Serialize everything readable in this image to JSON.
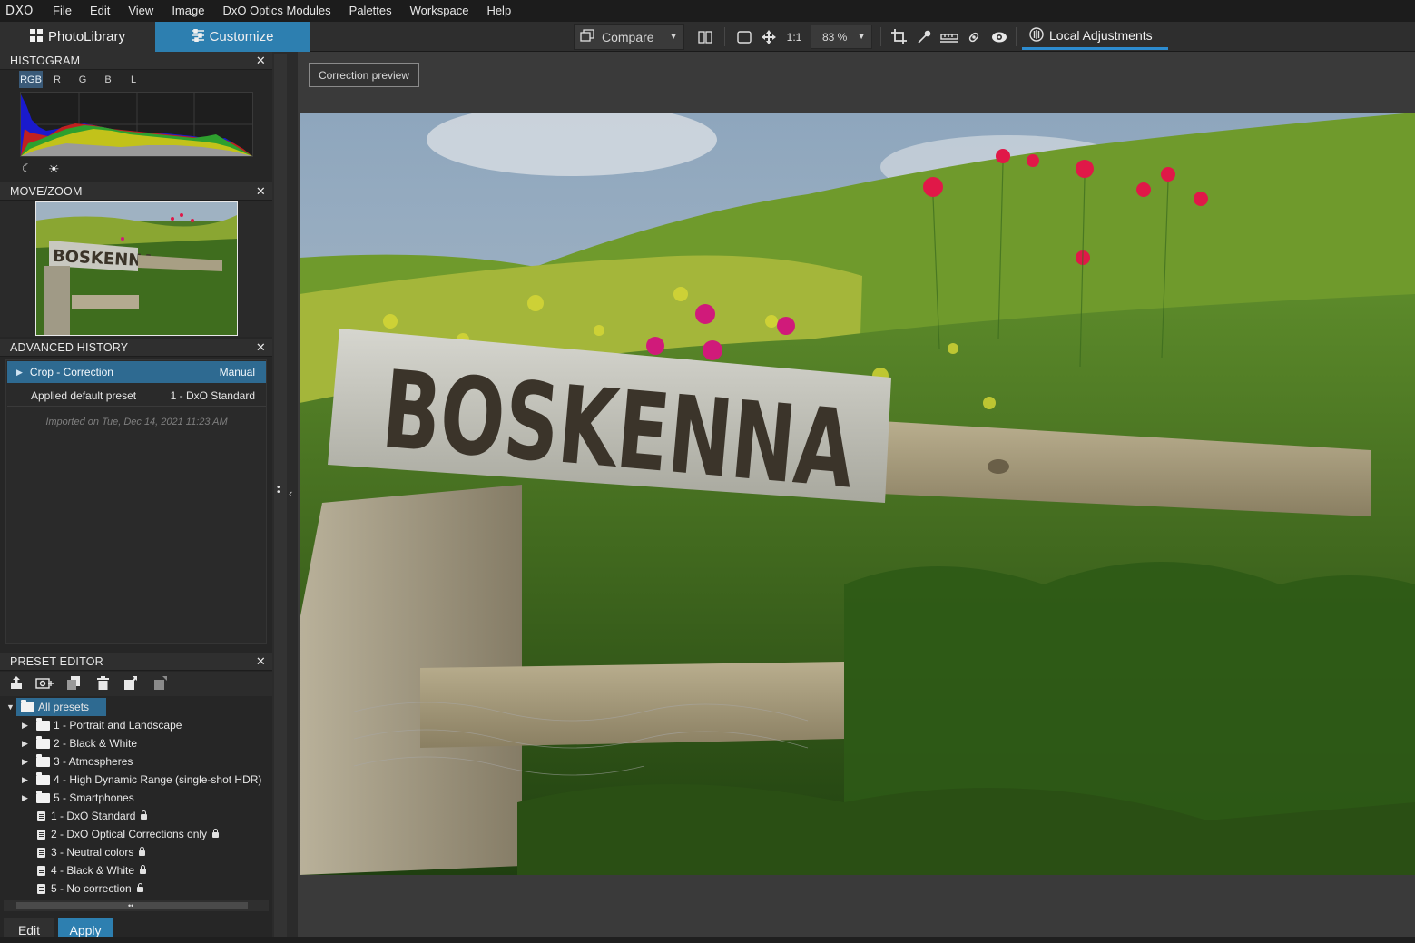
{
  "app": {
    "logo": "DXO"
  },
  "menu": [
    "File",
    "Edit",
    "View",
    "Image",
    "DxO Optics Modules",
    "Palettes",
    "Workspace",
    "Help"
  ],
  "modes": {
    "photolibrary": "PhotoLibrary",
    "customize": "Customize"
  },
  "toolbar": {
    "compare_label": "Compare",
    "one_to_one": "1:1",
    "zoom_value": "83 %",
    "local_adjustments": "Local Adjustments"
  },
  "histogram": {
    "title": "HISTOGRAM",
    "channels": [
      "RGB",
      "R",
      "G",
      "B",
      "L"
    ],
    "selected_channel": "RGB"
  },
  "movezoom": {
    "title": "MOVE/ZOOM",
    "sign_text": "BOSKENNA"
  },
  "history": {
    "title": "ADVANCED HISTORY",
    "rows": [
      {
        "action": "Crop - Correction",
        "value": "Manual"
      },
      {
        "action": "Applied default preset",
        "value": "1 - DxO Standard"
      }
    ],
    "imported": "Imported on Tue, Dec 14, 2021 11:23 AM"
  },
  "preset_editor": {
    "title": "PRESET EDITOR",
    "root": "All presets",
    "folders": [
      "1 - Portrait and Landscape",
      "2 - Black & White",
      "3 - Atmospheres",
      "4 - High Dynamic Range (single-shot HDR)",
      "5 - Smartphones"
    ],
    "presets": [
      "1 - DxO Standard",
      "2 - DxO Optical Corrections only",
      "3 - Neutral colors",
      "4 - Black & White",
      "5 - No correction"
    ],
    "edit_label": "Edit",
    "apply_label": "Apply"
  },
  "viewer": {
    "correction_preview": "Correction preview",
    "sign_text": "BOSKENNA"
  },
  "colors": {
    "accent": "#2d7fb0",
    "underline": "#2d8cd0",
    "selected_row": "#2e6a91"
  }
}
